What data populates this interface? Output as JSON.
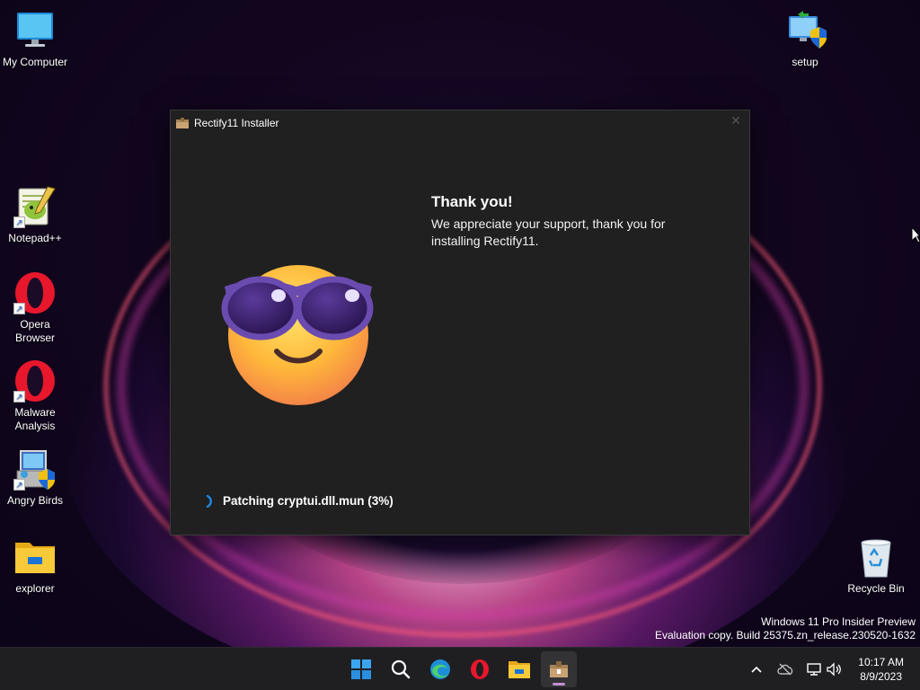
{
  "desktop": {
    "icons": [
      {
        "label": "My Computer",
        "icon": "monitor-icon"
      },
      {
        "label": "setup",
        "icon": "setup-shield-icon"
      },
      {
        "label": "Notepad++",
        "icon": "notepad-plus-plus-icon"
      },
      {
        "label": "Opera Browser",
        "icon": "opera-icon"
      },
      {
        "label": "Malware Analysis",
        "icon": "opera-icon"
      },
      {
        "label": "Angry Birds",
        "icon": "installer-icon"
      },
      {
        "label": "explorer",
        "icon": "folder-icon"
      },
      {
        "label": "Recycle Bin",
        "icon": "recycle-bin-icon"
      }
    ],
    "watermark": {
      "line1": "Windows 11 Pro Insider Preview",
      "line2": "Evaluation copy. Build 25375.zn_release.230520-1632"
    }
  },
  "installer": {
    "title": "Rectify11 Installer",
    "heading": "Thank you!",
    "message": "We appreciate your support, thank you for installing Rectify11.",
    "status": "Patching cryptui.dll.mun (3%)",
    "progress_percent": 3
  },
  "taskbar": {
    "apps": [
      "start-icon",
      "search-icon",
      "edge-icon",
      "opera-icon",
      "file-explorer-icon",
      "installer-icon"
    ],
    "clock": {
      "time": "10:17 AM",
      "date": "8/9/2023"
    }
  },
  "colors": {
    "window_bg": "#202020",
    "taskbar_bg": "#1f1f22",
    "accent": "#0078d4"
  }
}
